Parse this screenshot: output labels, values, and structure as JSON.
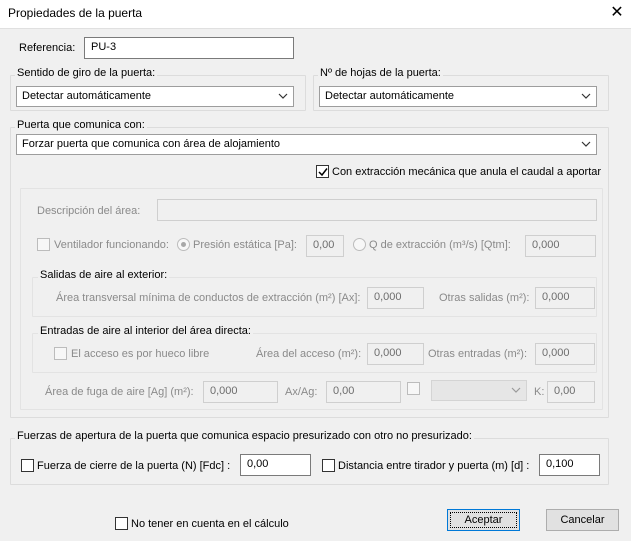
{
  "window": {
    "title": "Propiedades de la puerta",
    "close_glyph": "✕"
  },
  "referencia": {
    "label": "Referencia:",
    "value": "PU-3"
  },
  "sentido_giro": {
    "label": "Sentido de giro de la puerta:",
    "selected": "Detectar automáticamente"
  },
  "num_hojas": {
    "label": "Nº de hojas de la puerta:",
    "selected": "Detectar automáticamente"
  },
  "comunica": {
    "label": "Puerta que comunica con:",
    "selected": "Forzar puerta que comunica con área de alojamiento",
    "extraccion_label": "Con extracción mecánica que anula el caudal a aportar",
    "extraccion_checked": true
  },
  "area": {
    "descripcion_label": "Descripción del área:",
    "descripcion_value": "",
    "ventilador_label": "Ventilador funcionando:",
    "presion_label": "Presión estática [Pa]:",
    "presion_value": "0,00",
    "q_label": "Q de extracción  (m³/s) [Qtm]:",
    "q_value": "0,000"
  },
  "salidas": {
    "title": "Salidas de aire al exterior:",
    "area_label": "Área transversal mínima  de conductos de extracción (m²) [Ax]:",
    "area_value": "0,000",
    "otras_label": "Otras salidas (m²):",
    "otras_value": "0,000"
  },
  "entradas": {
    "title": "Entradas de aire al interior del área directa:",
    "hueco_label": "El acceso es por hueco libre",
    "acceso_label": "Área del acceso (m²):",
    "acceso_value": "0,000",
    "otras_label": "Otras entradas (m²):",
    "otras_value": "0,000"
  },
  "fuga": {
    "label": "Área de fuga de aire [Ag] (m²):",
    "value": "0,000",
    "axag_label": "Ax/Ag:",
    "axag_value": "0,00",
    "k_label": "K:",
    "k_value": "0,00",
    "k_select_value": ""
  },
  "fuerzas": {
    "title": "Fuerzas de apertura de la puerta que comunica espacio presurizado con otro no presurizado:",
    "cierre_label": "Fuerza de cierre de la puerta (N) [Fdc] :",
    "cierre_value": "0,00",
    "distancia_label": "Distancia entre tirador y puerta (m) [d] :",
    "distancia_value": "0,100"
  },
  "footer": {
    "no_tener_label": "No tener en cuenta en el cálculo",
    "aceptar_label": "Aceptar",
    "cancelar_label": "Cancelar"
  },
  "colors": {
    "accent_border": "#0078d7",
    "disabled_text": "#8a8a8a"
  }
}
